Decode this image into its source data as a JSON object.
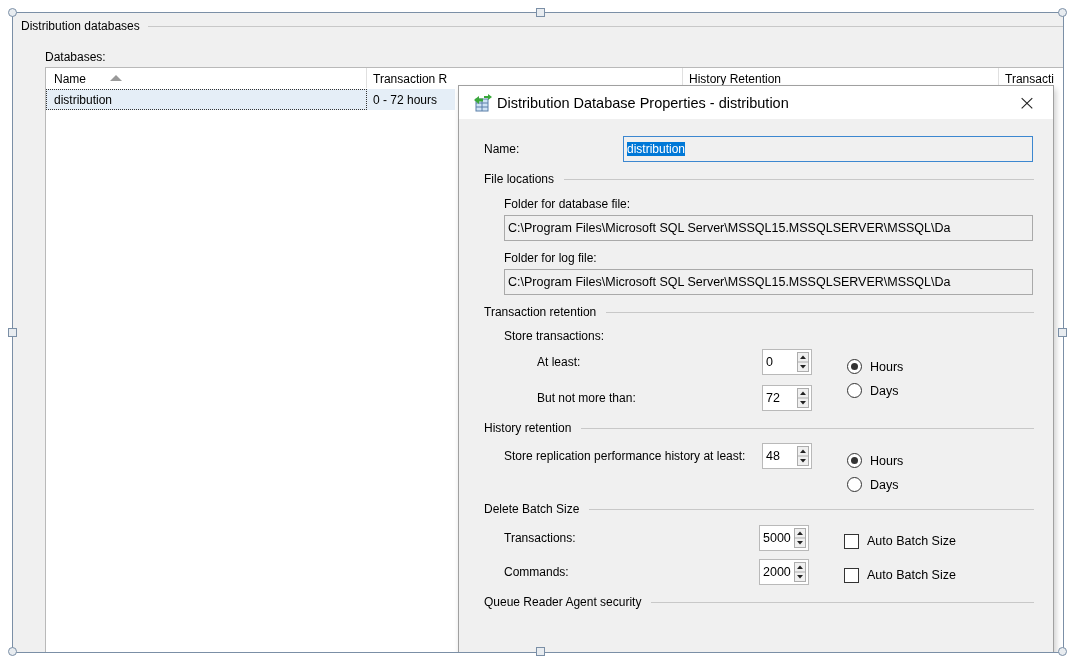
{
  "group_box": {
    "title": "Distribution databases"
  },
  "databases": {
    "label": "Databases:",
    "columns": [
      {
        "label": "Name",
        "sorted": true
      },
      {
        "label": "Transaction R"
      },
      {
        "label": "History Retention"
      },
      {
        "label": "Transacti"
      }
    ],
    "rows": [
      {
        "cells": [
          "distribution",
          "0 - 72 hours"
        ],
        "selected": true
      }
    ]
  },
  "dialog": {
    "title": "Distribution Database Properties - distribution",
    "close": "×",
    "name": {
      "label": "Name:",
      "value": "distribution",
      "selected": true
    },
    "sections": [
      {
        "title": "File locations",
        "items": [
          {
            "kind": "path",
            "label": "Folder for database file:",
            "value": "C:\\Program Files\\Microsoft SQL Server\\MSSQL15.MSSQLSERVER\\MSSQL\\Da"
          },
          {
            "kind": "path",
            "label": "Folder for log file:",
            "value": "C:\\Program Files\\Microsoft SQL Server\\MSSQL15.MSSQLSERVER\\MSSQL\\Da"
          }
        ]
      },
      {
        "title": "Transaction retention",
        "items": [
          {
            "kind": "spin_group",
            "caption": "Store transactions:",
            "spins": [
              {
                "label": "At least:",
                "value": "0"
              },
              {
                "label": "But not more than:",
                "value": "72"
              }
            ],
            "options": [
              {
                "label": "Hours",
                "selected": true
              },
              {
                "label": "Days",
                "selected": false
              }
            ]
          }
        ]
      },
      {
        "title": "History retention",
        "items": [
          {
            "kind": "spin_group",
            "spins": [
              {
                "label": "Store replication performance history at least:",
                "value": "48"
              }
            ],
            "options": [
              {
                "label": "Hours",
                "selected": true
              },
              {
                "label": "Days",
                "selected": false
              }
            ]
          }
        ]
      },
      {
        "title": "Delete Batch Size",
        "items": [
          {
            "kind": "spin_check",
            "label": "Transactions:",
            "value": "5000",
            "check": {
              "label": "Auto Batch Size",
              "checked": false
            }
          },
          {
            "kind": "spin_check",
            "label": "Commands:",
            "value": "2000",
            "check": {
              "label": "Auto Batch Size",
              "checked": false
            }
          }
        ]
      },
      {
        "title": "Queue Reader Agent security"
      }
    ]
  }
}
